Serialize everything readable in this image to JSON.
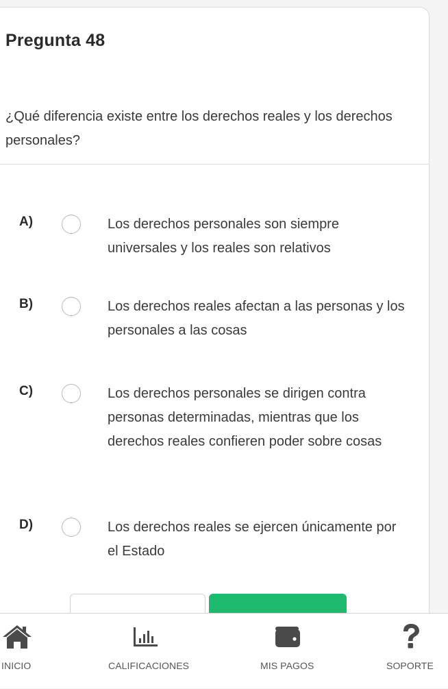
{
  "question": {
    "title": "Pregunta 48",
    "text": "¿Qué diferencia existe entre los derechos reales y los derechos personales?"
  },
  "options": [
    {
      "letter": "A)",
      "text": "Los derechos personales son siempre universales y los reales son relativos"
    },
    {
      "letter": "B)",
      "text": "Los derechos reales afectan a las personas y los personales a las cosas"
    },
    {
      "letter": "C)",
      "text": "Los derechos personales se dirigen contra personas determinadas, mientras que los derechos reales confieren poder sobre cosas"
    },
    {
      "letter": "D)",
      "text": "Los derechos reales se ejercen únicamente por el Estado"
    }
  ],
  "nav": {
    "items": [
      {
        "label": "INICIO",
        "icon": "home-icon"
      },
      {
        "label": "CALIFICACIONES",
        "icon": "bar-chart-icon"
      },
      {
        "label": "MIS PAGOS",
        "icon": "wallet-icon"
      },
      {
        "label": "SOPORTE",
        "icon": "question-icon"
      }
    ]
  },
  "colors": {
    "accent": "#1dba6e",
    "icon": "#4a4a4a"
  }
}
